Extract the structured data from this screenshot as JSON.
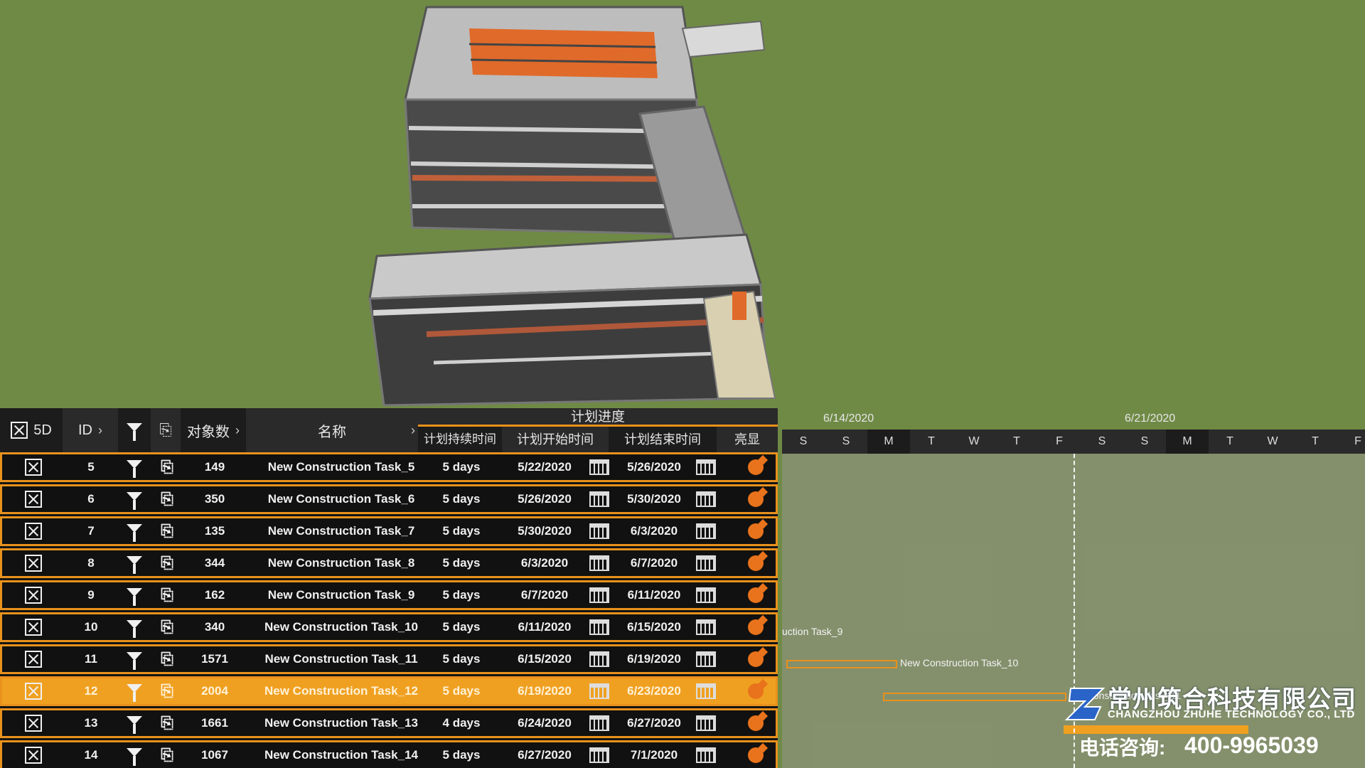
{
  "toolbar": {
    "mode_label": "5D"
  },
  "table": {
    "headers": {
      "id": "ID",
      "object_count": "对象数",
      "name": "名称",
      "plan_group": "计划进度",
      "duration": "计划持续时间",
      "start": "计划开始时间",
      "end": "计划结束时间",
      "highlight": "亮显"
    },
    "rows": [
      {
        "id": "5",
        "count": "149",
        "name": "New Construction Task_5",
        "duration": "5 days",
        "start": "5/22/2020",
        "end": "5/26/2020"
      },
      {
        "id": "6",
        "count": "350",
        "name": "New Construction Task_6",
        "duration": "5 days",
        "start": "5/26/2020",
        "end": "5/30/2020"
      },
      {
        "id": "7",
        "count": "135",
        "name": "New Construction Task_7",
        "duration": "5 days",
        "start": "5/30/2020",
        "end": "6/3/2020"
      },
      {
        "id": "8",
        "count": "344",
        "name": "New Construction Task_8",
        "duration": "5 days",
        "start": "6/3/2020",
        "end": "6/7/2020"
      },
      {
        "id": "9",
        "count": "162",
        "name": "New Construction Task_9",
        "duration": "5 days",
        "start": "6/7/2020",
        "end": "6/11/2020"
      },
      {
        "id": "10",
        "count": "340",
        "name": "New Construction Task_10",
        "duration": "5 days",
        "start": "6/11/2020",
        "end": "6/15/2020"
      },
      {
        "id": "11",
        "count": "1571",
        "name": "New Construction Task_11",
        "duration": "5 days",
        "start": "6/15/2020",
        "end": "6/19/2020"
      },
      {
        "id": "12",
        "count": "2004",
        "name": "New Construction Task_12",
        "duration": "5 days",
        "start": "6/19/2020",
        "end": "6/23/2020"
      },
      {
        "id": "13",
        "count": "1661",
        "name": "New Construction Task_13",
        "duration": "4 days",
        "start": "6/24/2020",
        "end": "6/27/2020"
      },
      {
        "id": "14",
        "count": "1067",
        "name": "New Construction Task_14",
        "duration": "5 days",
        "start": "6/27/2020",
        "end": "7/1/2020"
      }
    ],
    "selected_id": "12"
  },
  "gantt": {
    "week_labels": [
      "6/14/2020",
      "6/21/2020"
    ],
    "days": [
      "S",
      "S",
      "M",
      "T",
      "W",
      "T",
      "F",
      "S",
      "S",
      "M",
      "T",
      "W",
      "T",
      "F"
    ],
    "bar_labels": {
      "task9": "uction Task_9",
      "task10": "New Construction Task_10",
      "task11": "ew Construction Task_11"
    }
  },
  "watermark": {
    "company_cn": "常州筑合科技有限公司",
    "company_en": "CHANGZHOU ZHUHE TECHNOLOGY CO., LTD",
    "tel_label": "电话咨询:",
    "tel": "400-9965039"
  },
  "colors": {
    "accent": "#e8911c",
    "ground": "#6f8a45",
    "panel": "#141414"
  }
}
